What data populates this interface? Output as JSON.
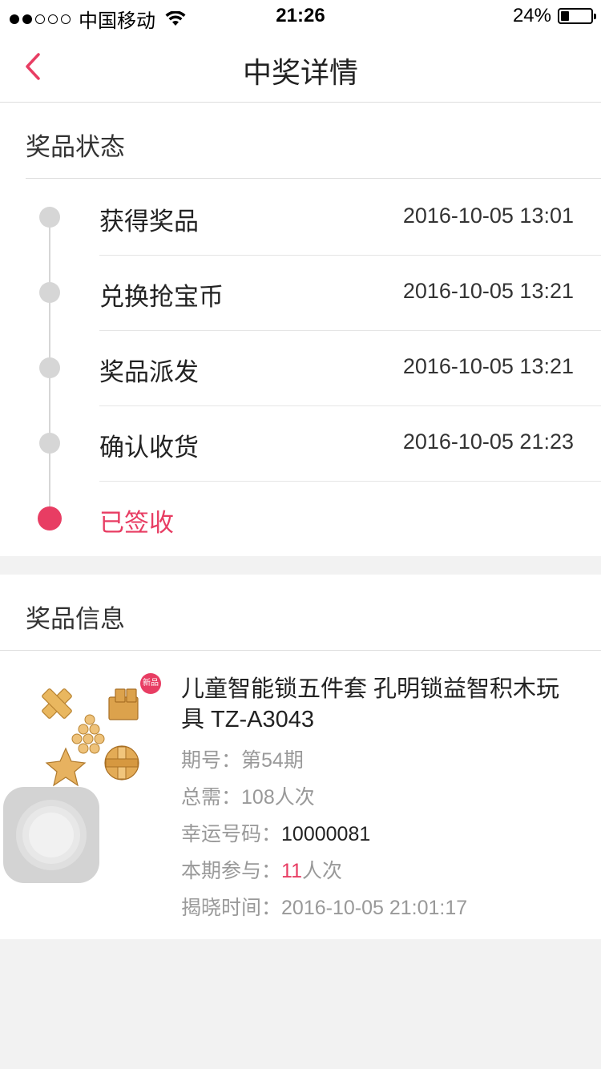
{
  "status_bar": {
    "carrier": "中国移动",
    "time": "21:26",
    "battery": "24%"
  },
  "header": {
    "title": "中奖详情"
  },
  "prize_status": {
    "title": "奖品状态",
    "steps": [
      {
        "label": "获得奖品",
        "time": "2016-10-05 13:01"
      },
      {
        "label": "兑换抢宝币",
        "time": "2016-10-05 13:21"
      },
      {
        "label": "奖品派发",
        "time": "2016-10-05 13:21"
      },
      {
        "label": "确认收货",
        "time": "2016-10-05 21:23"
      },
      {
        "label": "已签收",
        "time": ""
      }
    ]
  },
  "prize_info": {
    "title": "奖品信息",
    "badge": "新品",
    "name": "儿童智能锁五件套 孔明锁益智积木玩具 TZ-A3043",
    "period_label": "期号：",
    "period_value": "第54期",
    "total_label": "总需：",
    "total_value": "108人次",
    "lucky_label": "幸运号码：",
    "lucky_value": "10000081",
    "participate_label": "本期参与：",
    "participate_count": "11",
    "participate_unit": "人次",
    "reveal_label": "揭晓时间：",
    "reveal_value": "2016-10-05 21:01:17"
  },
  "colors": {
    "accent": "#e83d63",
    "node_gray": "#d6d6d6",
    "background": "#f2f2f2"
  },
  "icons": {
    "back": "chevron-left-icon",
    "wifi": "wifi-icon",
    "battery": "battery-icon",
    "assistive": "assistive-touch-icon"
  }
}
